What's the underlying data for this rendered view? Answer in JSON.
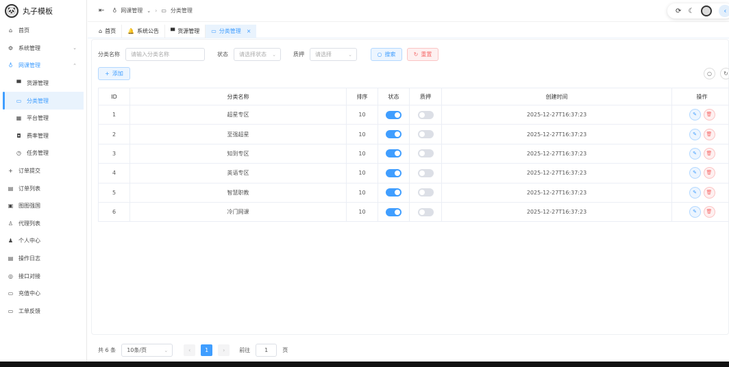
{
  "app": {
    "title": "丸子模板"
  },
  "sidebar": {
    "items": [
      {
        "label": "首页",
        "icon": "⌂"
      },
      {
        "label": "系统管理",
        "icon": "⚙",
        "chevron": "⌄"
      },
      {
        "label": "网课管理",
        "icon": "♁",
        "chevron": "⌃"
      },
      {
        "label": "货源管理",
        "icon": "▀"
      },
      {
        "label": "分类管理",
        "icon": "▭"
      },
      {
        "label": "平台管理",
        "icon": "▦"
      },
      {
        "label": "费率管理",
        "icon": "◘"
      },
      {
        "label": "任务管理",
        "icon": "◷"
      },
      {
        "label": "订单提交",
        "icon": "+"
      },
      {
        "label": "订单列表",
        "icon": "▤"
      },
      {
        "label": "图图强国",
        "icon": "▣"
      },
      {
        "label": "代理列表",
        "icon": "♙"
      },
      {
        "label": "个人中心",
        "icon": "♟"
      },
      {
        "label": "操作日志",
        "icon": "▤"
      },
      {
        "label": "接口对接",
        "icon": "◎"
      },
      {
        "label": "充值中心",
        "icon": "▭"
      },
      {
        "label": "工单反馈",
        "icon": "▭"
      }
    ]
  },
  "header": {
    "breadcrumb": [
      "网课管理",
      "分类管理"
    ],
    "collapse_icon": "⇤"
  },
  "tabs": [
    {
      "label": "首页",
      "icon": "⌂"
    },
    {
      "label": "系统公告",
      "icon": "🔔"
    },
    {
      "label": "货源管理",
      "icon": "▀"
    },
    {
      "label": "分类管理",
      "icon": "▭",
      "close": "×"
    }
  ],
  "filters": {
    "name_label": "分类名称",
    "name_placeholder": "请输入分类名称",
    "status_label": "状态",
    "status_placeholder": "请选择状态",
    "pledge_label": "质押",
    "pledge_placeholder": "请选择",
    "search": "搜索",
    "reset": "重置"
  },
  "add_label": "添加",
  "table": {
    "headers": [
      "ID",
      "分类名称",
      "排序",
      "状态",
      "质押",
      "创建时间",
      "操作"
    ],
    "rows": [
      {
        "id": "1",
        "name": "超星专区",
        "sort": "10",
        "status": true,
        "pledge": false,
        "created": "2025-12-27T16:37:23"
      },
      {
        "id": "2",
        "name": "至强超星",
        "sort": "10",
        "status": true,
        "pledge": false,
        "created": "2025-12-27T16:37:23"
      },
      {
        "id": "3",
        "name": "知到专区",
        "sort": "10",
        "status": true,
        "pledge": false,
        "created": "2025-12-27T16:37:23"
      },
      {
        "id": "4",
        "name": "英语专区",
        "sort": "10",
        "status": true,
        "pledge": false,
        "created": "2025-12-27T16:37:23"
      },
      {
        "id": "5",
        "name": "智慧职教",
        "sort": "10",
        "status": true,
        "pledge": false,
        "created": "2025-12-27T16:37:23"
      },
      {
        "id": "6",
        "name": "冷门网课",
        "sort": "10",
        "status": true,
        "pledge": false,
        "created": "2025-12-27T16:37:23"
      }
    ]
  },
  "pagination": {
    "total": "共 6 条",
    "page_size": "10条/页",
    "current": "1",
    "goto_label": "前往",
    "goto_value": "1",
    "page_suffix": "页",
    "prev": "‹",
    "next": "›"
  }
}
